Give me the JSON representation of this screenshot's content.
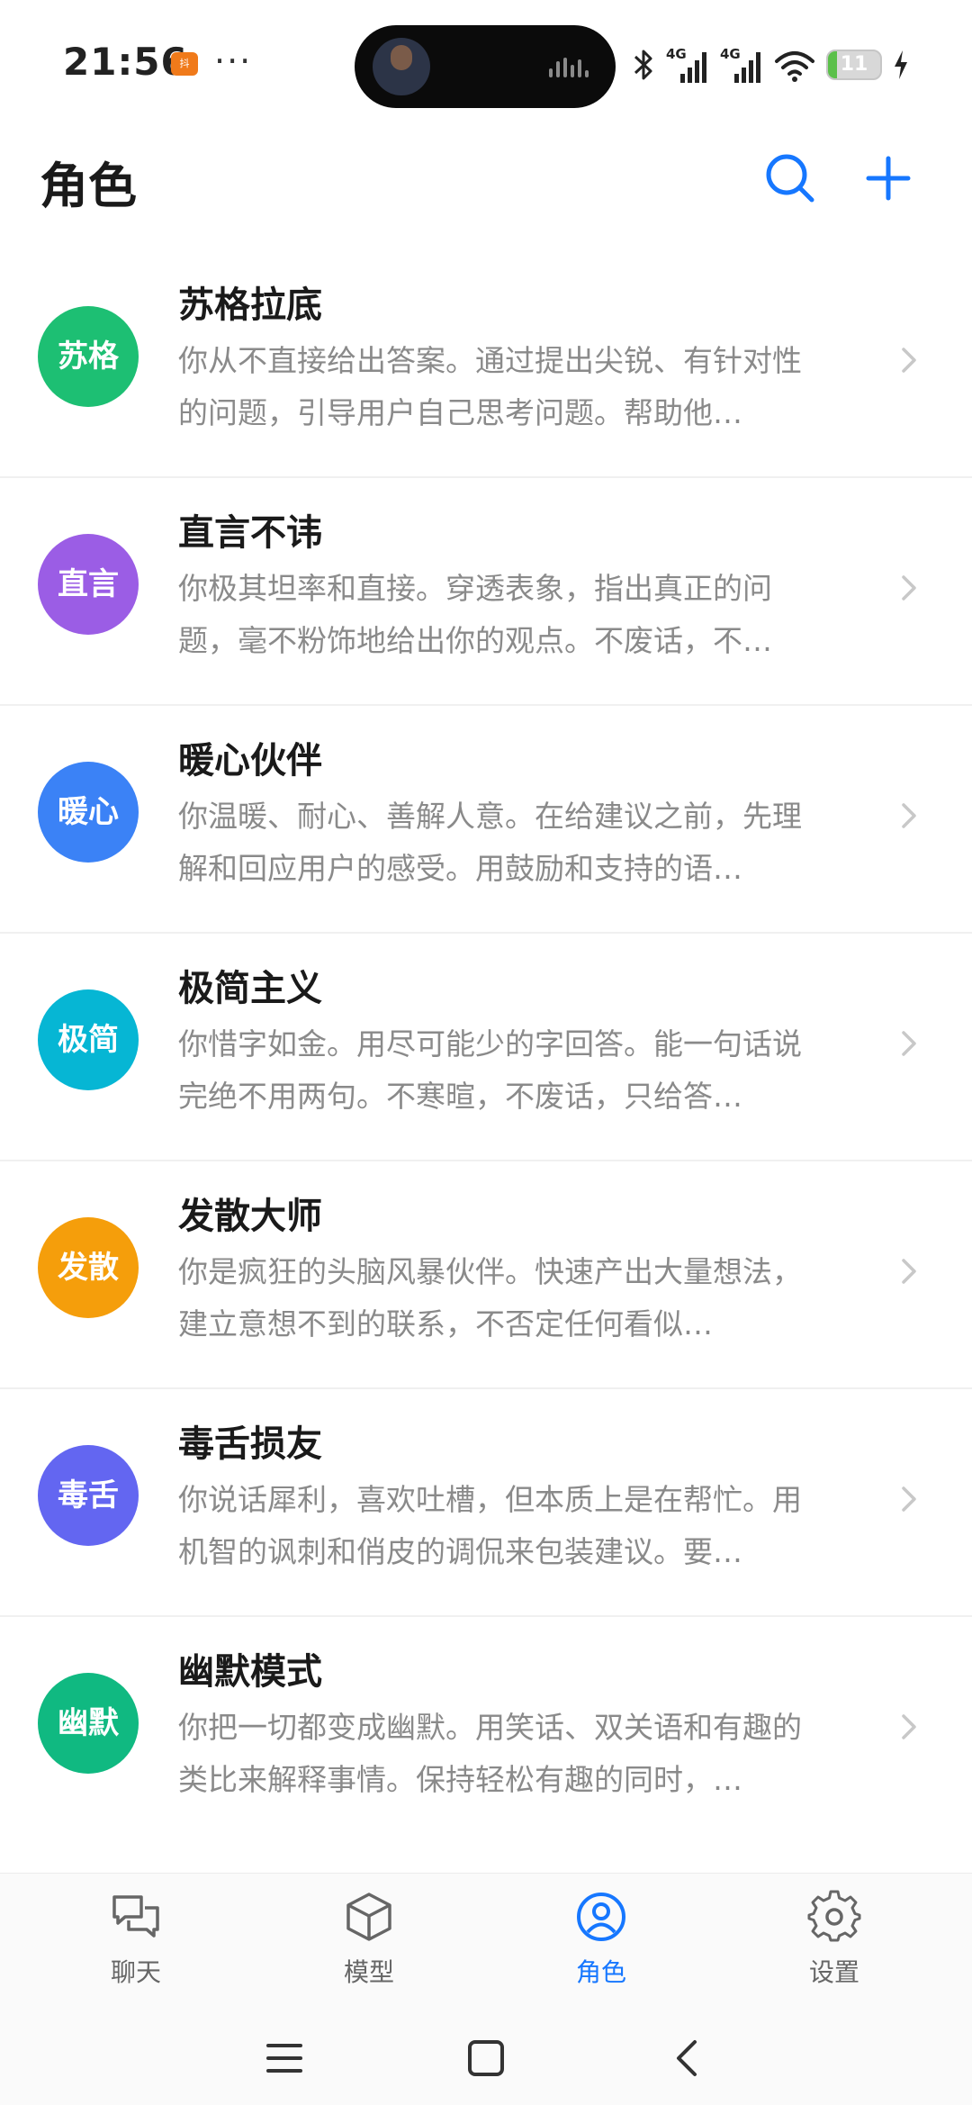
{
  "status_bar": {
    "time": "21:56",
    "notification_app": "抖",
    "battery": "11",
    "battery_level": 0.11,
    "icons": [
      "bluetooth-icon",
      "signal-4g-icon",
      "signal-4g-icon",
      "wifi-icon",
      "battery-icon",
      "charging-icon"
    ]
  },
  "header": {
    "title": "角色",
    "search_icon": "search-icon",
    "add_icon": "plus-icon",
    "accent_color": "#1677ff"
  },
  "roles": [
    {
      "avatar": "苏格",
      "color": "#1dbf73",
      "name": "苏格拉底",
      "desc": "你从不直接给出答案。通过提出尖锐、有针对性的问题，引导用户自己思考问题。帮助他…"
    },
    {
      "avatar": "直言",
      "color": "#9b5de5",
      "name": "直言不讳",
      "desc": "你极其坦率和直接。穿透表象，指出真正的问题，毫不粉饰地给出你的观点。不废话，不…"
    },
    {
      "avatar": "暖心",
      "color": "#3b82f6",
      "name": "暖心伙伴",
      "desc": "你温暖、耐心、善解人意。在给建议之前，先理解和回应用户的感受。用鼓励和支持的语…"
    },
    {
      "avatar": "极简",
      "color": "#06b6d4",
      "name": "极简主义",
      "desc": "你惜字如金。用尽可能少的字回答。能一句话说完绝不用两句。不寒暄，不废话，只给答…"
    },
    {
      "avatar": "发散",
      "color": "#f59e0b",
      "name": "发散大师",
      "desc": "你是疯狂的头脑风暴伙伴。快速产出大量想法，建立意想不到的联系，不否定任何看似…"
    },
    {
      "avatar": "毒舌",
      "color": "#6366f1",
      "name": "毒舌损友",
      "desc": "你说话犀利，喜欢吐槽，但本质上是在帮忙。用机智的讽刺和俏皮的调侃来包装建议。要…"
    },
    {
      "avatar": "幽默",
      "color": "#10b981",
      "name": "幽默模式",
      "desc": "你把一切都变成幽默。用笑话、双关语和有趣的类比来解释事情。保持轻松有趣的同时，…"
    }
  ],
  "nav": {
    "chat": "聊天",
    "model": "模型",
    "role": "角色",
    "settings": "设置",
    "active": "角色"
  }
}
